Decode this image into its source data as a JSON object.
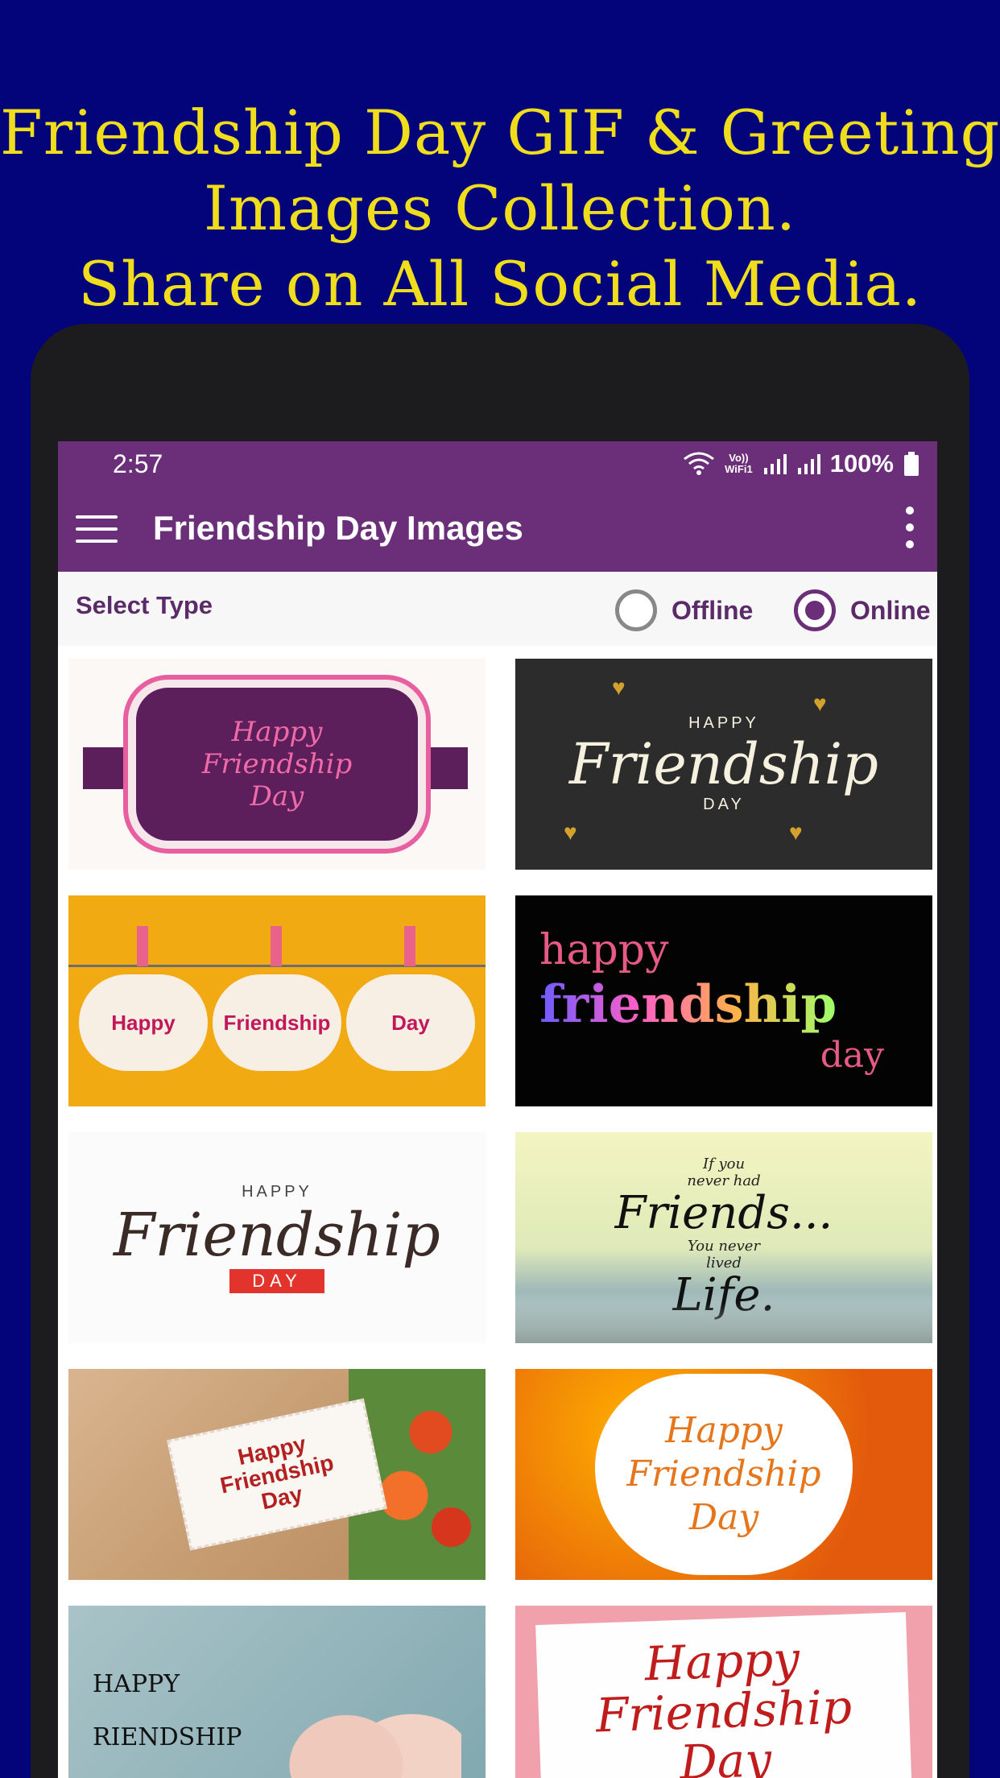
{
  "promo": {
    "line1": "Friendship Day GIF & Greeting",
    "line2": "Images Collection.",
    "line3": "Share on All Social Media."
  },
  "status": {
    "time": "2:57",
    "volte_top": "Vo))",
    "volte_bottom": "WiFi1",
    "battery": "100%",
    "icons": [
      "wifi-icon",
      "signal-icon",
      "signal-icon",
      "battery-icon"
    ]
  },
  "appbar": {
    "title": "Friendship Day Images",
    "icons": [
      "menu-icon",
      "more-vertical-icon"
    ]
  },
  "type": {
    "label": "Select Type",
    "options": [
      {
        "label": "Offline",
        "selected": false
      },
      {
        "label": "Online",
        "selected": true
      }
    ]
  },
  "images": [
    {
      "lines": [
        "Happy",
        "Friendship",
        "Day"
      ]
    },
    {
      "small": "HAPPY",
      "big": "Friendship",
      "small2": "DAY"
    },
    {
      "words": [
        "Happy",
        "Friendship",
        "Day"
      ]
    },
    {
      "a": "happy",
      "b": "friendship",
      "c": "day"
    },
    {
      "small": "HAPPY",
      "big": "Friendship",
      "tag": "DAY"
    },
    {
      "s1": "If you",
      "s2": "never had",
      "big1": "Friends...",
      "s3": "You never",
      "s4": "lived",
      "big2": "Life."
    },
    {
      "lines": [
        "Happy",
        "Friendship",
        "Day"
      ]
    },
    {
      "lines": [
        "Happy",
        "Friendship",
        "Day"
      ]
    },
    {
      "lines": [
        "HAPPY",
        "RIENDSHIP"
      ]
    },
    {
      "lines": [
        "Happy",
        "Friendship",
        "Day"
      ]
    }
  ],
  "colors": {
    "background": "#04047a",
    "promo_text": "#f0de1c",
    "appbar": "#6a2f78"
  }
}
